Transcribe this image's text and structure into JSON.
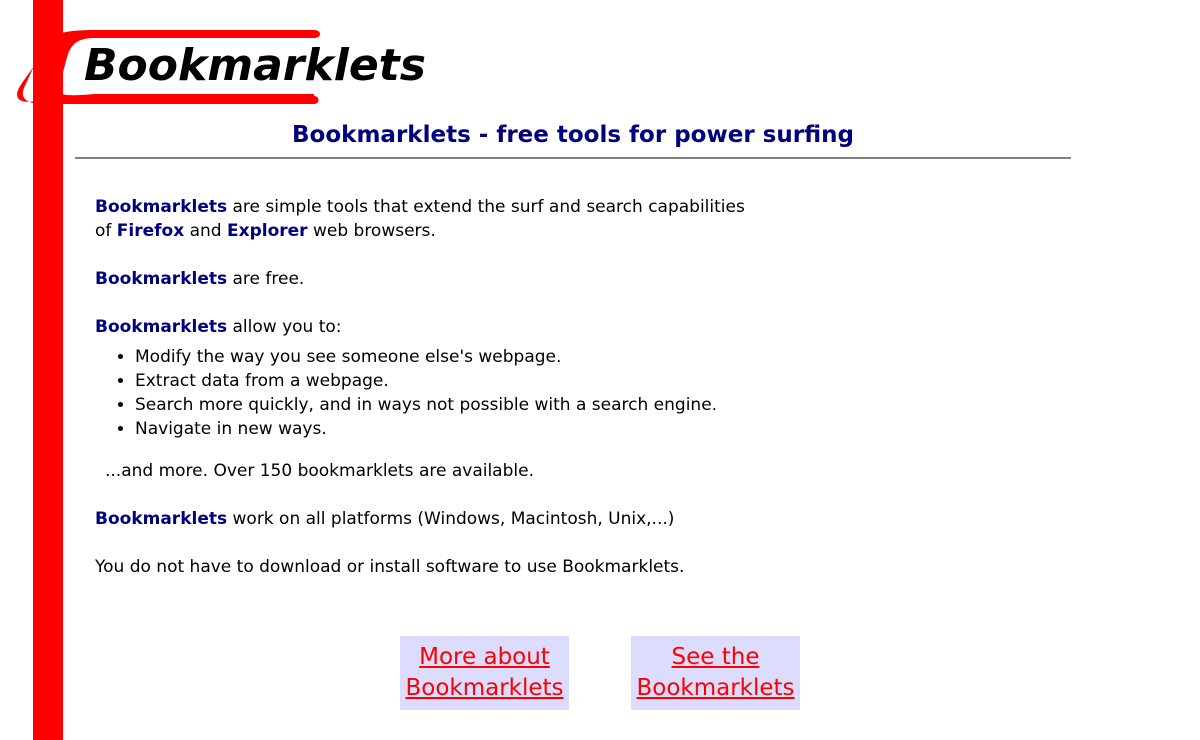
{
  "logo": {
    "text": "Bookmarklets"
  },
  "header": {
    "title": "Bookmarklets - free tools for power surfing"
  },
  "content": {
    "intro": {
      "kw1": "Bookmarklets",
      "t1": " are simple tools that extend the surf and search capabilities",
      "t2": "of ",
      "kw2": "Firefox",
      "t3": " and ",
      "kw3": "Explorer",
      "t4": " web browsers."
    },
    "free": {
      "kw": "Bookmarklets",
      "text": " are free."
    },
    "allow": {
      "kw": "Bookmarklets",
      "text": " allow you to:"
    },
    "features": [
      "Modify the way you see someone else's webpage.",
      "Extract data from a webpage.",
      "Search more quickly, and in ways not possible with a search engine.",
      "Navigate in new ways."
    ],
    "more": "...and more. Over 150 bookmarklets are available.",
    "platforms": {
      "kw": "Bookmarklets",
      "text": " work on all platforms (Windows, Macintosh, Unix,...)"
    },
    "no_install": "You do not have to download or install software to use Bookmarklets."
  },
  "buttons": {
    "more_about": {
      "line1": "More about",
      "line2": "Bookmarklets"
    },
    "see_the": {
      "line1": "See the",
      "line2": "Bookmarklets"
    }
  },
  "colors": {
    "accent_red": "#ff0000",
    "keyword_navy": "#000080",
    "button_bg": "#dcdcff",
    "rule_gray": "#808080"
  }
}
